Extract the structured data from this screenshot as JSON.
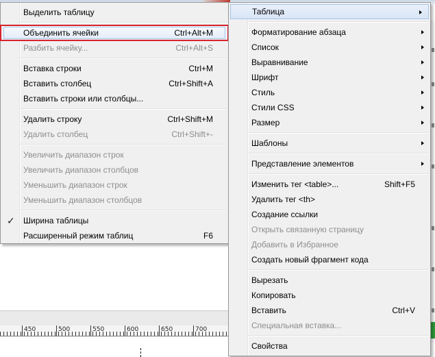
{
  "left_menu": {
    "items": [
      {
        "type": "item",
        "label": "Выделить таблицу",
        "shortcut": "",
        "disabled": false
      },
      {
        "type": "sep"
      },
      {
        "type": "item",
        "label": "Объединить ячейки",
        "shortcut": "Ctrl+Alt+M",
        "disabled": false,
        "highlighted": true
      },
      {
        "type": "item",
        "label": "Разбить ячейку...",
        "shortcut": "Ctrl+Alt+S",
        "disabled": true
      },
      {
        "type": "sep"
      },
      {
        "type": "item",
        "label": "Вставка строки",
        "shortcut": "Ctrl+M",
        "disabled": false
      },
      {
        "type": "item",
        "label": "Вставить столбец",
        "shortcut": "Ctrl+Shift+A",
        "disabled": false
      },
      {
        "type": "item",
        "label": "Вставить строки или столбцы...",
        "shortcut": "",
        "disabled": false
      },
      {
        "type": "sep"
      },
      {
        "type": "item",
        "label": "Удалить строку",
        "shortcut": "Ctrl+Shift+M",
        "disabled": false
      },
      {
        "type": "item",
        "label": "Удалить столбец",
        "shortcut": "Ctrl+Shift+-",
        "disabled": true
      },
      {
        "type": "sep"
      },
      {
        "type": "item",
        "label": "Увеличить диапазон строк",
        "shortcut": "",
        "disabled": true
      },
      {
        "type": "item",
        "label": "Увеличить диапазон столбцов",
        "shortcut": "",
        "disabled": true
      },
      {
        "type": "item",
        "label": "Уменьшить диапазон строк",
        "shortcut": "",
        "disabled": true
      },
      {
        "type": "item",
        "label": "Уменьшить диапазон столбцов",
        "shortcut": "",
        "disabled": true
      },
      {
        "type": "sep"
      },
      {
        "type": "item",
        "label": "Ширина таблицы",
        "shortcut": "",
        "disabled": false,
        "checked": true
      },
      {
        "type": "item",
        "label": "Расширенный режим таблиц",
        "shortcut": "F6",
        "disabled": false
      }
    ]
  },
  "right_menu": {
    "items": [
      {
        "type": "item",
        "label": "Таблица",
        "shortcut": "",
        "submenu": true,
        "active": true
      },
      {
        "type": "sep"
      },
      {
        "type": "item",
        "label": "Форматирование абзаца",
        "submenu": true
      },
      {
        "type": "item",
        "label": "Список",
        "submenu": true
      },
      {
        "type": "item",
        "label": "Выравнивание",
        "submenu": true
      },
      {
        "type": "item",
        "label": "Шрифт",
        "submenu": true
      },
      {
        "type": "item",
        "label": "Стиль",
        "submenu": true
      },
      {
        "type": "item",
        "label": "Стили CSS",
        "submenu": true
      },
      {
        "type": "item",
        "label": "Размер",
        "submenu": true
      },
      {
        "type": "sep"
      },
      {
        "type": "item",
        "label": "Шаблоны",
        "submenu": true
      },
      {
        "type": "sep"
      },
      {
        "type": "item",
        "label": "Представление элементов",
        "submenu": true
      },
      {
        "type": "sep"
      },
      {
        "type": "item",
        "label": "Изменить тег <table>...",
        "shortcut": "Shift+F5"
      },
      {
        "type": "item",
        "label": "Удалить тег <th>"
      },
      {
        "type": "item",
        "label": "Создание ссылки"
      },
      {
        "type": "item",
        "label": "Открыть связанную страницу",
        "disabled": true
      },
      {
        "type": "item",
        "label": "Добавить в Избранное",
        "disabled": true
      },
      {
        "type": "item",
        "label": "Создать новый фрагмент кода"
      },
      {
        "type": "sep"
      },
      {
        "type": "item",
        "label": "Вырезать"
      },
      {
        "type": "item",
        "label": "Копировать"
      },
      {
        "type": "item",
        "label": "Вставить",
        "shortcut": "Ctrl+V"
      },
      {
        "type": "item",
        "label": "Специальная вставка...",
        "disabled": true
      },
      {
        "type": "sep"
      },
      {
        "type": "item",
        "label": "Свойства"
      }
    ]
  },
  "ruler": {
    "labels": [
      "450",
      "500",
      "550",
      "600",
      "650",
      "700"
    ]
  },
  "icons": {
    "check": "check-icon",
    "submenu_arrow": "submenu-arrow-icon"
  }
}
